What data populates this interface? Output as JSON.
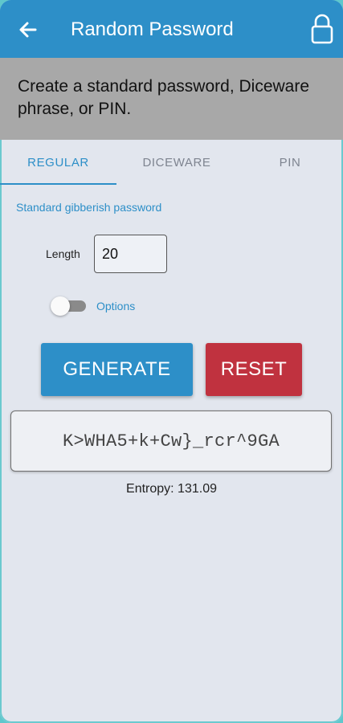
{
  "app": {
    "title": "Random Password",
    "back_icon": "arrow-left-icon",
    "lock_icon": "lock-icon"
  },
  "banner": {
    "text": "Create a standard password, Diceware phrase, or PIN."
  },
  "tabs": [
    {
      "label": "REGULAR",
      "active": true
    },
    {
      "label": "DICEWARE",
      "active": false
    },
    {
      "label": "PIN",
      "active": false
    }
  ],
  "regular": {
    "subtitle": "Standard gibberish password",
    "length_label": "Length",
    "length_value": "20",
    "options_label": "Options",
    "options_enabled": false
  },
  "actions": {
    "generate_label": "GENERATE",
    "reset_label": "RESET"
  },
  "result": {
    "password": "K>WHA5+k+Cw}_rcr^9GA",
    "entropy": "Entropy: 131.09"
  },
  "colors": {
    "primary": "#2d8fc8",
    "danger": "#c0323f",
    "banner": "#a8a8a8",
    "background": "#e2e6ee",
    "outer": "#5fc7cc"
  }
}
